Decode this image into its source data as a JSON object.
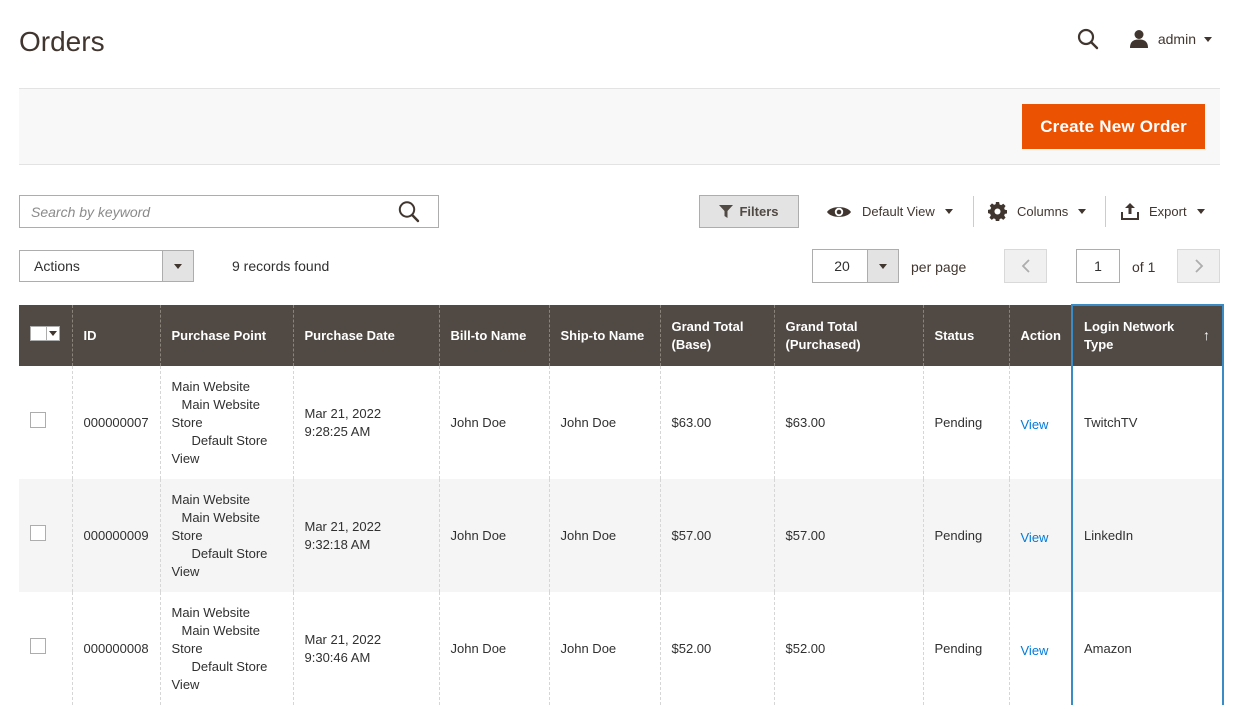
{
  "page": {
    "title": "Orders"
  },
  "header": {
    "user_name": "admin"
  },
  "action_bar": {
    "create_label": "Create New Order"
  },
  "toolbar": {
    "search_placeholder": "Search by keyword",
    "filters_label": "Filters",
    "view_label": "Default View",
    "columns_label": "Columns",
    "export_label": "Export",
    "actions_label": "Actions",
    "records_text": "9 records found",
    "per_page_value": "20",
    "per_page_label": "per page",
    "current_page": "1",
    "page_of": "of 1"
  },
  "grid": {
    "columns": [
      "ID",
      "Purchase Point",
      "Purchase Date",
      "Bill-to Name",
      "Ship-to Name",
      "Grand Total (Base)",
      "Grand Total (Purchased)",
      "Status",
      "Action",
      "Login Network Type"
    ],
    "sort_indicator": "↑",
    "rows": [
      {
        "id": "000000007",
        "purchase_point": {
          "website": "Main Website",
          "store": "Main Website",
          "store2": "Store",
          "view": "Default Store",
          "view2": "View"
        },
        "date": "Mar 21, 2022",
        "time": "9:28:25 AM",
        "bill_to": "John Doe",
        "ship_to": "John Doe",
        "total_base": "$63.00",
        "total_purchased": "$63.00",
        "status": "Pending",
        "action": "View",
        "network": "TwitchTV"
      },
      {
        "id": "000000009",
        "purchase_point": {
          "website": "Main Website",
          "store": "Main Website",
          "store2": "Store",
          "view": "Default Store",
          "view2": "View"
        },
        "date": "Mar 21, 2022",
        "time": "9:32:18 AM",
        "bill_to": "John Doe",
        "ship_to": "John Doe",
        "total_base": "$57.00",
        "total_purchased": "$57.00",
        "status": "Pending",
        "action": "View",
        "network": "LinkedIn"
      },
      {
        "id": "000000008",
        "purchase_point": {
          "website": "Main Website",
          "store": "Main Website",
          "store2": "Store",
          "view": "Default Store",
          "view2": "View"
        },
        "date": "Mar 21, 2022",
        "time": "9:30:46 AM",
        "bill_to": "John Doe",
        "ship_to": "John Doe",
        "total_base": "$52.00",
        "total_purchased": "$52.00",
        "status": "Pending",
        "action": "View",
        "network": "Amazon"
      }
    ]
  },
  "colors": {
    "accent": "#eb5202",
    "header_bg": "#514943",
    "link": "#007bdb",
    "sort_highlight": "#3a8cc6"
  }
}
